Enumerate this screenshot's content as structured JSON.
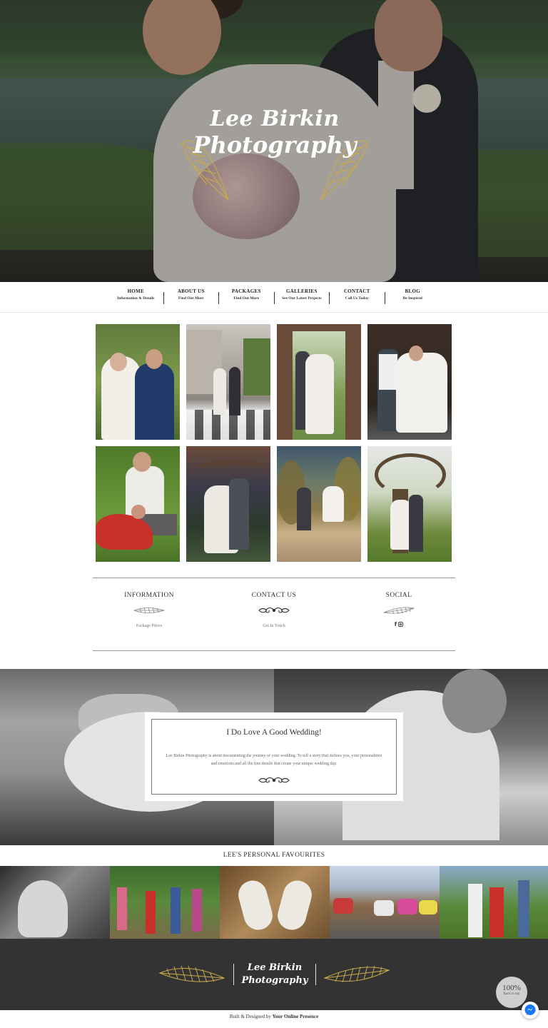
{
  "hero": {
    "logo_line1": "Lee Birkin",
    "logo_line2": "Photography",
    "accent_color": "#c9a94e"
  },
  "nav": {
    "items": [
      {
        "title": "HOME",
        "sub": "Information & Details"
      },
      {
        "title": "ABOUT US",
        "sub": "Find Out More"
      },
      {
        "title": "PACKAGES",
        "sub": "Find Out More"
      },
      {
        "title": "GALLERIES",
        "sub": "See Our Latest Projects"
      },
      {
        "title": "CONTACT",
        "sub": "Call Us Today"
      },
      {
        "title": "BLOG",
        "sub": "Be Inspired"
      }
    ]
  },
  "info": {
    "columns": [
      {
        "heading": "INFORMATION",
        "link": "Package Prices"
      },
      {
        "heading": "CONTACT US",
        "link": "Get In Touch"
      },
      {
        "heading": "SOCIAL",
        "icons": [
          "facebook-icon",
          "instagram-icon"
        ]
      }
    ]
  },
  "quote": {
    "title": "I Do Love A Good Wedding!",
    "text": "Lee Birkin Photography is about documenting the journey of your wedding. To tell a story that defines you, your personalities and emotions and all the fine details that create your unique wedding day."
  },
  "favourites": {
    "title": "LEE'S PERSONAL FAVOURITES"
  },
  "footer": {
    "logo_line1": "Lee Birkin",
    "logo_line2": "Photography",
    "back_to_top_pct": "100%",
    "back_to_top_label": "Back to top",
    "credit_prefix": "Built & Designed by",
    "credit_name": "Your Online Presence"
  }
}
